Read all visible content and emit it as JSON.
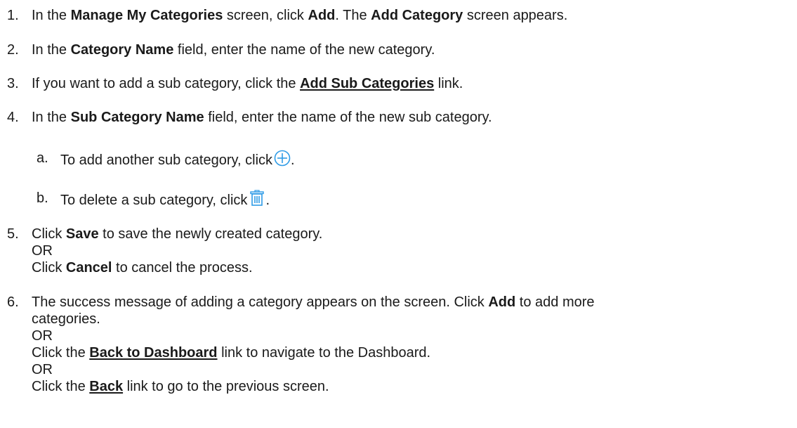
{
  "steps": [
    {
      "num": "1.",
      "t1": "In the ",
      "b1": "Manage My Categories",
      "t2": " screen, click ",
      "b2": "Add",
      "t3": ". The ",
      "b3": "Add Category",
      "t4": " screen appears."
    },
    {
      "num": "2.",
      "t1": "In the ",
      "b1": "Category Name",
      "t2": " field, enter the name of the new category."
    },
    {
      "num": "3.",
      "t1": "If you want to add a sub category, click the ",
      "link": "Add Sub Categories",
      "t2": " link."
    },
    {
      "num": "4.",
      "t1": "In the ",
      "b1": "Sub Category Name",
      "t2": " field, enter the name of the new sub category.",
      "sub": [
        {
          "letter": "a.",
          "text": "To add another sub category, click",
          "icon": "add-circle-icon",
          "end": "."
        },
        {
          "letter": "b.",
          "text": "To delete a sub category, click",
          "icon": "trash-icon",
          "end": "."
        }
      ]
    },
    {
      "num": "5.",
      "t1": "Click ",
      "b1": "Save",
      "t2": " to save the newly created category.",
      "or1": "OR",
      "t3": "Click ",
      "b2": "Cancel",
      "t4": " to cancel the process."
    },
    {
      "num": "6.",
      "t1": "The success message of adding a category appears on the screen. Click ",
      "b1": "Add",
      "t2": " to add more",
      "t2b": "categories.",
      "or1": "OR",
      "t3": "Click the ",
      "link1": "Back to Dashboard",
      "t4": " link to navigate to the Dashboard.",
      "or2": "OR",
      "t5": "Click the ",
      "link2": "Back",
      "t6": " link to go to the previous screen."
    }
  ],
  "colors": {
    "text": "#1a1a1a",
    "icon": "#2e9be6"
  }
}
